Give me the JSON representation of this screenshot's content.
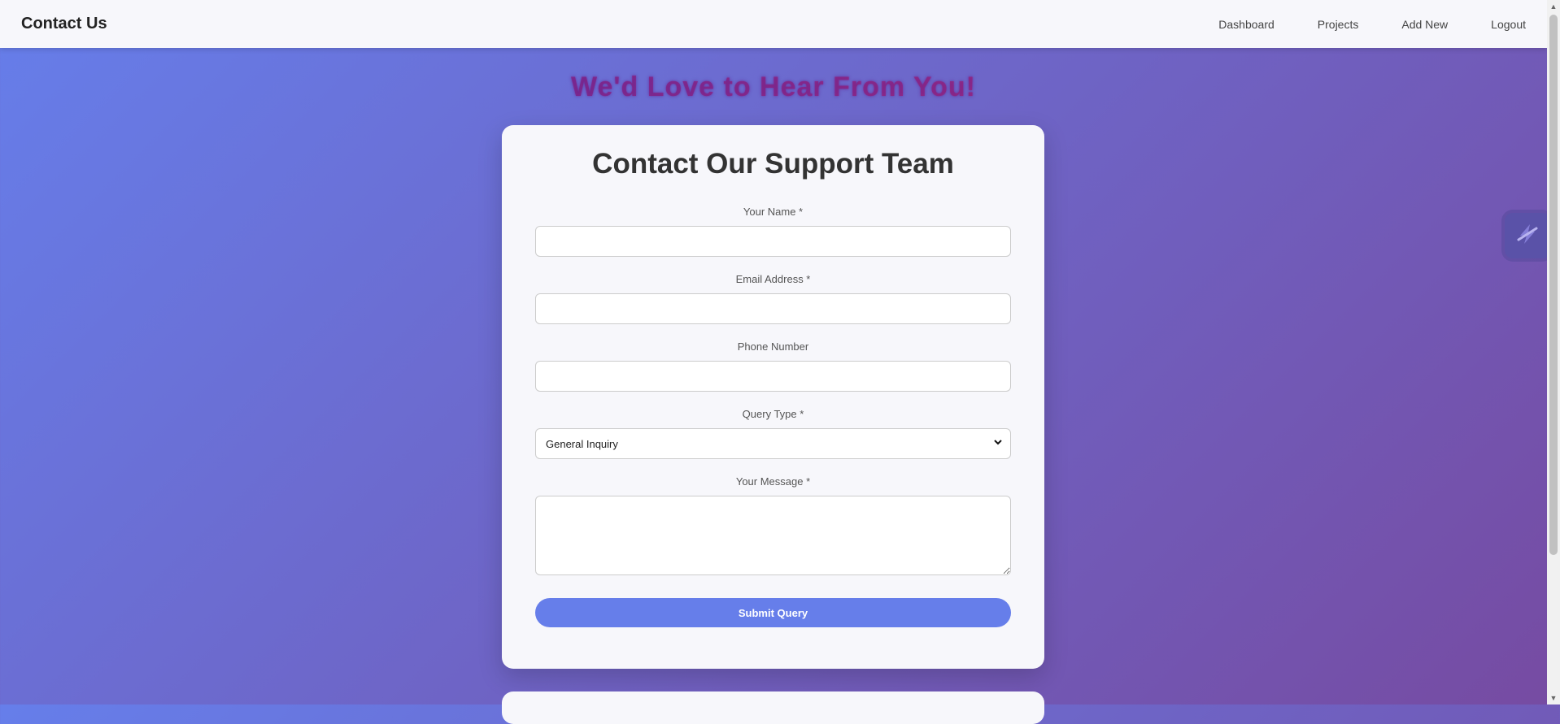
{
  "navbar": {
    "brand": "Contact Us",
    "links": [
      "Dashboard",
      "Projects",
      "Add New",
      "Logout"
    ]
  },
  "hero": {
    "title": "We'd Love to Hear From You!"
  },
  "form": {
    "title": "Contact Our Support Team",
    "fields": {
      "name": {
        "label": "Your Name *",
        "value": ""
      },
      "email": {
        "label": "Email Address *",
        "value": ""
      },
      "phone": {
        "label": "Phone Number",
        "value": ""
      },
      "query_type": {
        "label": "Query Type *",
        "selected": "General Inquiry"
      },
      "message": {
        "label": "Your Message *",
        "value": ""
      }
    },
    "submit_label": "Submit Query"
  },
  "icons": {
    "side_widget": "lightning-bolt-icon",
    "select_arrow": "chevron-down-icon"
  },
  "colors": {
    "accent": "#667eea",
    "gradient_start": "#667eea",
    "gradient_end": "#764ba2"
  }
}
